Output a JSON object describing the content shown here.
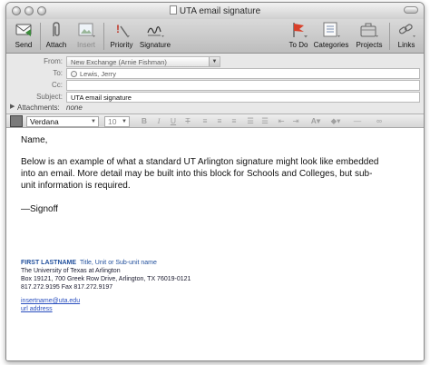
{
  "window": {
    "title": "UTA email signature"
  },
  "toolbar": {
    "send": "Send",
    "attach": "Attach",
    "insert": "Insert",
    "priority": "Priority",
    "signature": "Signature",
    "todo": "To Do",
    "categories": "Categories",
    "projects": "Projects",
    "links": "Links"
  },
  "headers": {
    "from_label": "From:",
    "from_value": "New Exchange (Arnie Fishman)",
    "to_label": "To:",
    "to_value": "Lewis, Jerry",
    "cc_label": "Cc:",
    "cc_value": "",
    "subject_label": "Subject:",
    "subject_value": "UTA email signature",
    "attachments_label": "Attachments:",
    "attachments_value": "none"
  },
  "format": {
    "font": "Verdana",
    "size": "10",
    "bold": "B",
    "italic": "I",
    "underline": "U",
    "strike": "T"
  },
  "message": {
    "greeting": "Name,",
    "para_line1": "Below is an example of what a standard UT Arlington signature might look like embedded",
    "para_line2": "into an email.  More detail may be built into this block for Schools and Colleges, but sub-",
    "para_line3": "unit information is required.",
    "signoff": "—Signoff"
  },
  "signature": {
    "name": "FIRST LASTNAME",
    "title": "Title, Unit or Sub-unit name",
    "org": "The University of Texas at Arlington",
    "address": "Box 19121, 700 Greek Row Drive,  Arlington, TX 76019-0121",
    "phone": "817.272.9195  Fax 817.272.9197",
    "email": "insertname@uta.edu",
    "url": "url address"
  },
  "colors": {
    "signature_name": "#1f4e9c",
    "link": "#2a4fbf",
    "todo_flag": "#d8402a",
    "priority_mark": "#c0392b"
  }
}
